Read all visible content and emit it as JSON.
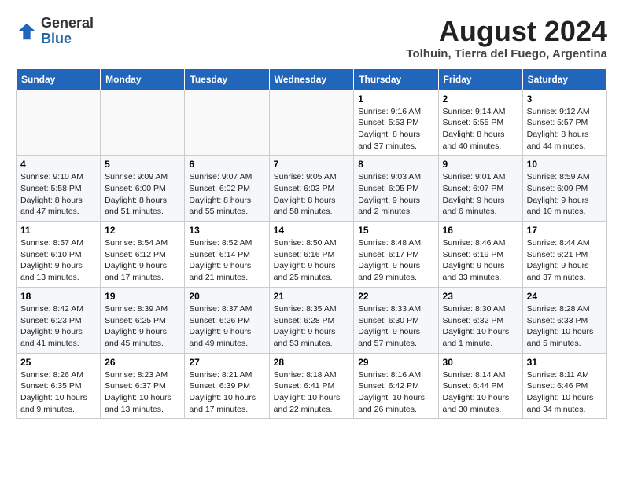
{
  "logo": {
    "general": "General",
    "blue": "Blue"
  },
  "title": "August 2024",
  "location": "Tolhuin, Tierra del Fuego, Argentina",
  "days_of_week": [
    "Sunday",
    "Monday",
    "Tuesday",
    "Wednesday",
    "Thursday",
    "Friday",
    "Saturday"
  ],
  "weeks": [
    [
      {
        "day": "",
        "info": ""
      },
      {
        "day": "",
        "info": ""
      },
      {
        "day": "",
        "info": ""
      },
      {
        "day": "",
        "info": ""
      },
      {
        "day": "1",
        "info": "Sunrise: 9:16 AM\nSunset: 5:53 PM\nDaylight: 8 hours and 37 minutes."
      },
      {
        "day": "2",
        "info": "Sunrise: 9:14 AM\nSunset: 5:55 PM\nDaylight: 8 hours and 40 minutes."
      },
      {
        "day": "3",
        "info": "Sunrise: 9:12 AM\nSunset: 5:57 PM\nDaylight: 8 hours and 44 minutes."
      }
    ],
    [
      {
        "day": "4",
        "info": "Sunrise: 9:10 AM\nSunset: 5:58 PM\nDaylight: 8 hours and 47 minutes."
      },
      {
        "day": "5",
        "info": "Sunrise: 9:09 AM\nSunset: 6:00 PM\nDaylight: 8 hours and 51 minutes."
      },
      {
        "day": "6",
        "info": "Sunrise: 9:07 AM\nSunset: 6:02 PM\nDaylight: 8 hours and 55 minutes."
      },
      {
        "day": "7",
        "info": "Sunrise: 9:05 AM\nSunset: 6:03 PM\nDaylight: 8 hours and 58 minutes."
      },
      {
        "day": "8",
        "info": "Sunrise: 9:03 AM\nSunset: 6:05 PM\nDaylight: 9 hours and 2 minutes."
      },
      {
        "day": "9",
        "info": "Sunrise: 9:01 AM\nSunset: 6:07 PM\nDaylight: 9 hours and 6 minutes."
      },
      {
        "day": "10",
        "info": "Sunrise: 8:59 AM\nSunset: 6:09 PM\nDaylight: 9 hours and 10 minutes."
      }
    ],
    [
      {
        "day": "11",
        "info": "Sunrise: 8:57 AM\nSunset: 6:10 PM\nDaylight: 9 hours and 13 minutes."
      },
      {
        "day": "12",
        "info": "Sunrise: 8:54 AM\nSunset: 6:12 PM\nDaylight: 9 hours and 17 minutes."
      },
      {
        "day": "13",
        "info": "Sunrise: 8:52 AM\nSunset: 6:14 PM\nDaylight: 9 hours and 21 minutes."
      },
      {
        "day": "14",
        "info": "Sunrise: 8:50 AM\nSunset: 6:16 PM\nDaylight: 9 hours and 25 minutes."
      },
      {
        "day": "15",
        "info": "Sunrise: 8:48 AM\nSunset: 6:17 PM\nDaylight: 9 hours and 29 minutes."
      },
      {
        "day": "16",
        "info": "Sunrise: 8:46 AM\nSunset: 6:19 PM\nDaylight: 9 hours and 33 minutes."
      },
      {
        "day": "17",
        "info": "Sunrise: 8:44 AM\nSunset: 6:21 PM\nDaylight: 9 hours and 37 minutes."
      }
    ],
    [
      {
        "day": "18",
        "info": "Sunrise: 8:42 AM\nSunset: 6:23 PM\nDaylight: 9 hours and 41 minutes."
      },
      {
        "day": "19",
        "info": "Sunrise: 8:39 AM\nSunset: 6:25 PM\nDaylight: 9 hours and 45 minutes."
      },
      {
        "day": "20",
        "info": "Sunrise: 8:37 AM\nSunset: 6:26 PM\nDaylight: 9 hours and 49 minutes."
      },
      {
        "day": "21",
        "info": "Sunrise: 8:35 AM\nSunset: 6:28 PM\nDaylight: 9 hours and 53 minutes."
      },
      {
        "day": "22",
        "info": "Sunrise: 8:33 AM\nSunset: 6:30 PM\nDaylight: 9 hours and 57 minutes."
      },
      {
        "day": "23",
        "info": "Sunrise: 8:30 AM\nSunset: 6:32 PM\nDaylight: 10 hours and 1 minute."
      },
      {
        "day": "24",
        "info": "Sunrise: 8:28 AM\nSunset: 6:33 PM\nDaylight: 10 hours and 5 minutes."
      }
    ],
    [
      {
        "day": "25",
        "info": "Sunrise: 8:26 AM\nSunset: 6:35 PM\nDaylight: 10 hours and 9 minutes."
      },
      {
        "day": "26",
        "info": "Sunrise: 8:23 AM\nSunset: 6:37 PM\nDaylight: 10 hours and 13 minutes."
      },
      {
        "day": "27",
        "info": "Sunrise: 8:21 AM\nSunset: 6:39 PM\nDaylight: 10 hours and 17 minutes."
      },
      {
        "day": "28",
        "info": "Sunrise: 8:18 AM\nSunset: 6:41 PM\nDaylight: 10 hours and 22 minutes."
      },
      {
        "day": "29",
        "info": "Sunrise: 8:16 AM\nSunset: 6:42 PM\nDaylight: 10 hours and 26 minutes."
      },
      {
        "day": "30",
        "info": "Sunrise: 8:14 AM\nSunset: 6:44 PM\nDaylight: 10 hours and 30 minutes."
      },
      {
        "day": "31",
        "info": "Sunrise: 8:11 AM\nSunset: 6:46 PM\nDaylight: 10 hours and 34 minutes."
      }
    ]
  ]
}
